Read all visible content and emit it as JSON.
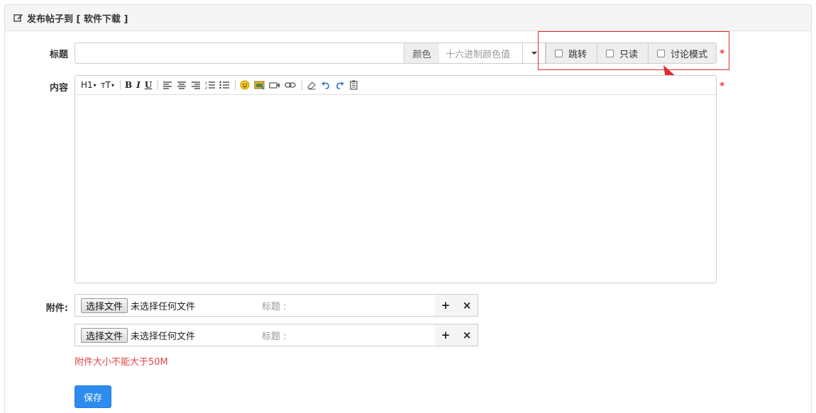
{
  "header": {
    "title": "发布帖子到 [ 软件下载 ]",
    "icon": "edit-icon"
  },
  "form": {
    "title_label": "标题",
    "color_label": "颜色",
    "color_placeholder": "十六进制颜色值",
    "options": [
      {
        "label": "跳转",
        "checked": false
      },
      {
        "label": "只读",
        "checked": false
      },
      {
        "label": "讨论模式",
        "checked": false
      }
    ],
    "required_mark": "*",
    "content_label": "内容"
  },
  "editor": {
    "toolbar": {
      "heading": "H1",
      "fontsize": "тT",
      "bold": "B",
      "italic": "I",
      "underline": "U"
    }
  },
  "attachments": {
    "label": "附件:",
    "rows": [
      {
        "button": "选择文件",
        "status": "未选择任何文件",
        "title_placeholder": "标题 :"
      },
      {
        "button": "选择文件",
        "status": "未选择任何文件",
        "title_placeholder": "标题 :"
      }
    ],
    "add_symbol": "+",
    "remove_symbol": "×",
    "hint": "附件大小不能大于50M"
  },
  "actions": {
    "save": "保存"
  },
  "colors": {
    "accent": "#2d8cf0",
    "danger": "#e04545",
    "annotation": "#e52a2a"
  }
}
